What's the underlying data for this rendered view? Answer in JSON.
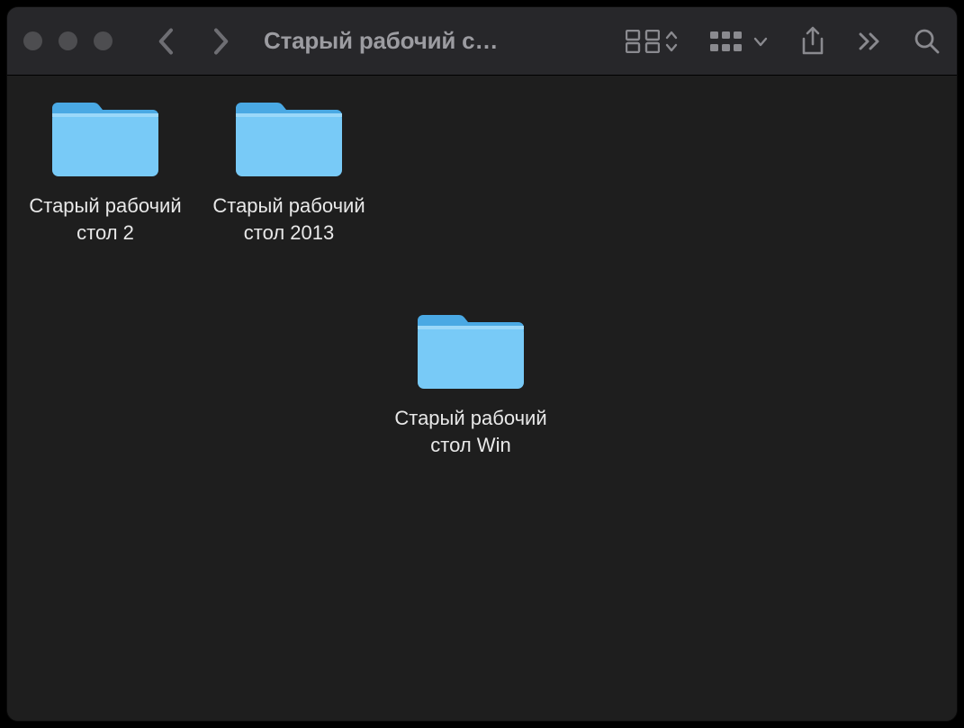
{
  "window": {
    "title": "Старый рабочий с…"
  },
  "items": [
    {
      "name": "Старый рабочий стол 2"
    },
    {
      "name": "Старый рабочий стол 2013"
    },
    {
      "name": "Старый рабочий стол Win"
    }
  ],
  "colors": {
    "folder_light": "#78caf7",
    "folder_dark": "#58b7ee",
    "tab": "#4aa9e4"
  }
}
